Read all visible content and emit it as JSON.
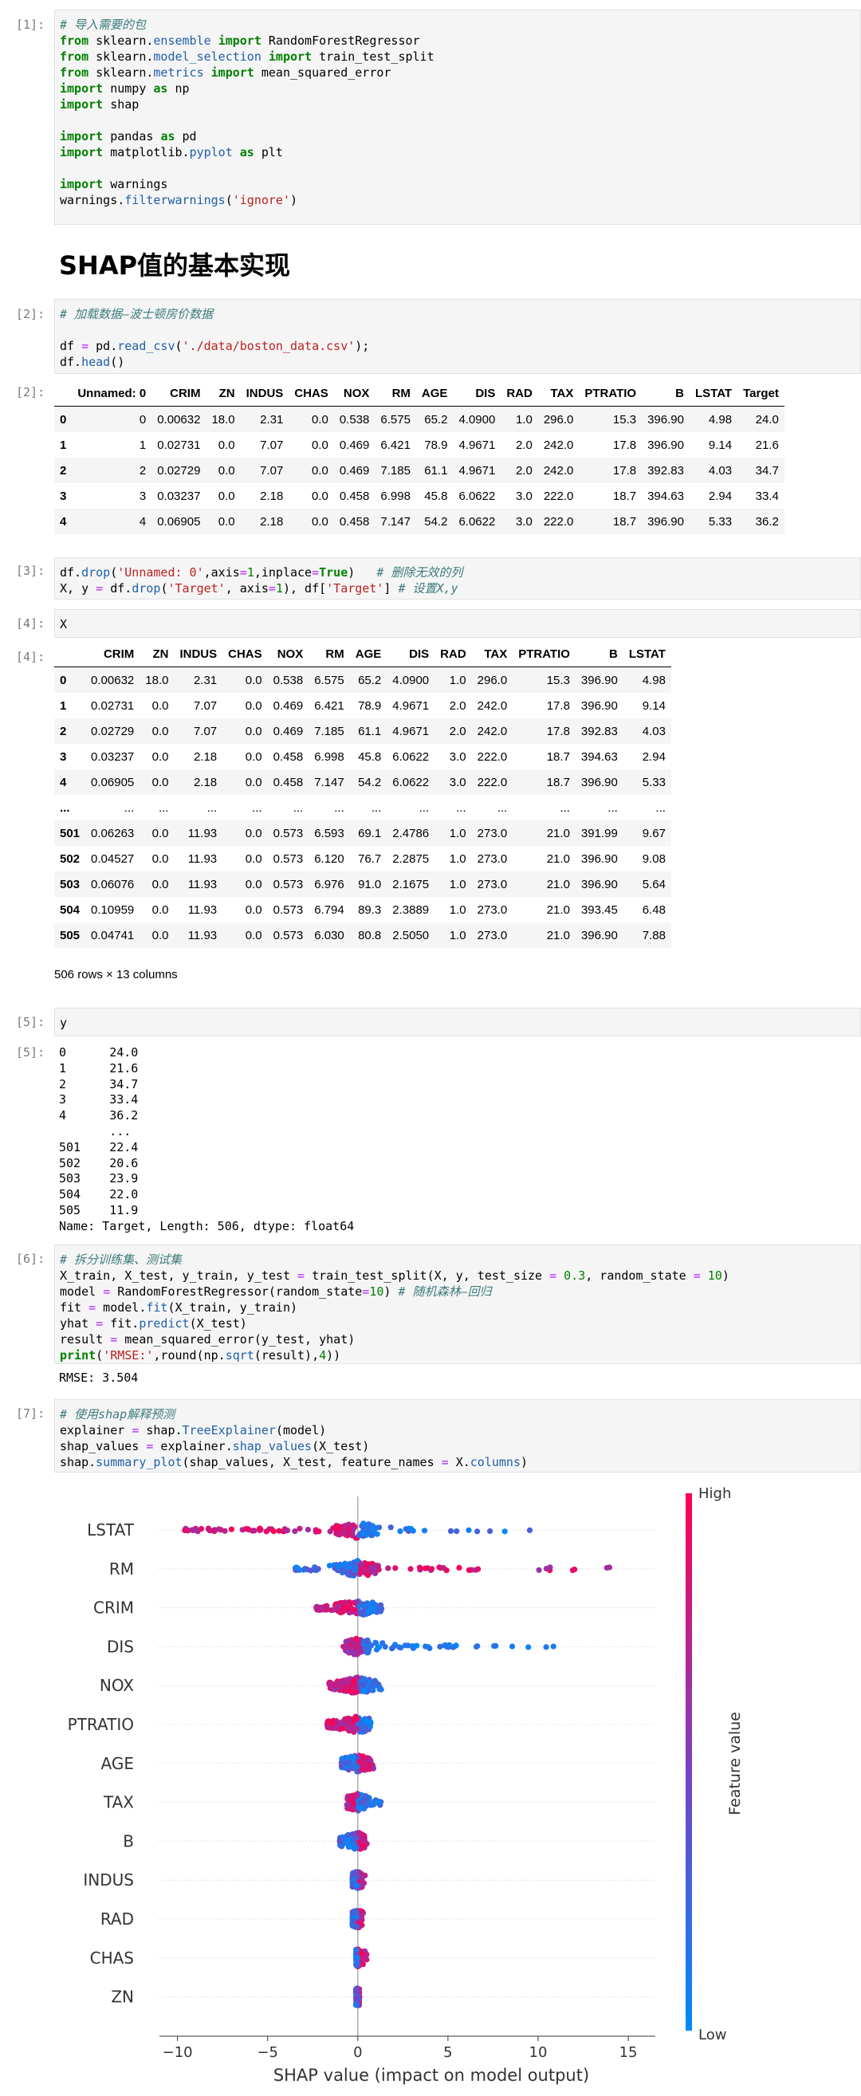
{
  "cells": {
    "c1": {
      "in": "[1]:"
    },
    "heading": "SHAP值的基本实现",
    "c2": {
      "in": "[2]:",
      "out": "[2]:"
    },
    "c3": {
      "in": "[3]:"
    },
    "c4": {
      "in": "[4]:",
      "out": "[4]:",
      "code": "X",
      "rows_info": "506 rows × 13 columns"
    },
    "c5": {
      "in": "[5]:",
      "out": "[5]:",
      "code": "y",
      "output": "0      24.0\n1      21.6\n2      34.7\n3      33.4\n4      36.2\n       ...\n501    22.4\n502    20.6\n503    23.9\n504    22.0\n505    11.9\nName: Target, Length: 506, dtype: float64"
    },
    "c6": {
      "in": "[6]:",
      "output": "RMSE: 3.504"
    },
    "c7": {
      "in": "[7]:"
    }
  },
  "table_full": {
    "columns": [
      "",
      "Unnamed: 0",
      "CRIM",
      "ZN",
      "INDUS",
      "CHAS",
      "NOX",
      "RM",
      "AGE",
      "DIS",
      "RAD",
      "TAX",
      "PTRATIO",
      "B",
      "LSTAT",
      "Target"
    ],
    "rows": [
      [
        "0",
        "0",
        "0.00632",
        "18.0",
        "2.31",
        "0.0",
        "0.538",
        "6.575",
        "65.2",
        "4.0900",
        "1.0",
        "296.0",
        "15.3",
        "396.90",
        "4.98",
        "24.0"
      ],
      [
        "1",
        "1",
        "0.02731",
        "0.0",
        "7.07",
        "0.0",
        "0.469",
        "6.421",
        "78.9",
        "4.9671",
        "2.0",
        "242.0",
        "17.8",
        "396.90",
        "9.14",
        "21.6"
      ],
      [
        "2",
        "2",
        "0.02729",
        "0.0",
        "7.07",
        "0.0",
        "0.469",
        "7.185",
        "61.1",
        "4.9671",
        "2.0",
        "242.0",
        "17.8",
        "392.83",
        "4.03",
        "34.7"
      ],
      [
        "3",
        "3",
        "0.03237",
        "0.0",
        "2.18",
        "0.0",
        "0.458",
        "6.998",
        "45.8",
        "6.0622",
        "3.0",
        "222.0",
        "18.7",
        "394.63",
        "2.94",
        "33.4"
      ],
      [
        "4",
        "4",
        "0.06905",
        "0.0",
        "2.18",
        "0.0",
        "0.458",
        "7.147",
        "54.2",
        "6.0622",
        "3.0",
        "222.0",
        "18.7",
        "396.90",
        "5.33",
        "36.2"
      ]
    ]
  },
  "table_x": {
    "columns": [
      "",
      "CRIM",
      "ZN",
      "INDUS",
      "CHAS",
      "NOX",
      "RM",
      "AGE",
      "DIS",
      "RAD",
      "TAX",
      "PTRATIO",
      "B",
      "LSTAT"
    ],
    "rows": [
      [
        "0",
        "0.00632",
        "18.0",
        "2.31",
        "0.0",
        "0.538",
        "6.575",
        "65.2",
        "4.0900",
        "1.0",
        "296.0",
        "15.3",
        "396.90",
        "4.98"
      ],
      [
        "1",
        "0.02731",
        "0.0",
        "7.07",
        "0.0",
        "0.469",
        "6.421",
        "78.9",
        "4.9671",
        "2.0",
        "242.0",
        "17.8",
        "396.90",
        "9.14"
      ],
      [
        "2",
        "0.02729",
        "0.0",
        "7.07",
        "0.0",
        "0.469",
        "7.185",
        "61.1",
        "4.9671",
        "2.0",
        "242.0",
        "17.8",
        "392.83",
        "4.03"
      ],
      [
        "3",
        "0.03237",
        "0.0",
        "2.18",
        "0.0",
        "0.458",
        "6.998",
        "45.8",
        "6.0622",
        "3.0",
        "222.0",
        "18.7",
        "394.63",
        "2.94"
      ],
      [
        "4",
        "0.06905",
        "0.0",
        "2.18",
        "0.0",
        "0.458",
        "7.147",
        "54.2",
        "6.0622",
        "3.0",
        "222.0",
        "18.7",
        "396.90",
        "5.33"
      ],
      [
        "...",
        "...",
        "...",
        "...",
        "...",
        "...",
        "...",
        "...",
        "...",
        "...",
        "...",
        "...",
        "...",
        "..."
      ],
      [
        "501",
        "0.06263",
        "0.0",
        "11.93",
        "0.0",
        "0.573",
        "6.593",
        "69.1",
        "2.4786",
        "1.0",
        "273.0",
        "21.0",
        "391.99",
        "9.67"
      ],
      [
        "502",
        "0.04527",
        "0.0",
        "11.93",
        "0.0",
        "0.573",
        "6.120",
        "76.7",
        "2.2875",
        "1.0",
        "273.0",
        "21.0",
        "396.90",
        "9.08"
      ],
      [
        "503",
        "0.06076",
        "0.0",
        "11.93",
        "0.0",
        "0.573",
        "6.976",
        "91.0",
        "2.1675",
        "1.0",
        "273.0",
        "21.0",
        "396.90",
        "5.64"
      ],
      [
        "504",
        "0.10959",
        "0.0",
        "11.93",
        "0.0",
        "0.573",
        "6.794",
        "89.3",
        "2.3889",
        "1.0",
        "273.0",
        "21.0",
        "393.45",
        "6.48"
      ],
      [
        "505",
        "0.04741",
        "0.0",
        "11.93",
        "0.0",
        "0.573",
        "6.030",
        "80.8",
        "2.5050",
        "1.0",
        "273.0",
        "21.0",
        "396.90",
        "7.88"
      ]
    ]
  },
  "chart_data": {
    "type": "scatter",
    "xlabel": "SHAP value (impact on model output)",
    "xlim": [
      -11,
      16.5
    ],
    "xticks": [
      -10,
      -5,
      0,
      5,
      10,
      15
    ],
    "colorbar": {
      "label": "Feature value",
      "high": "High",
      "low": "Low",
      "high_color": "#ff0052",
      "low_color": "#008bfb"
    },
    "features": [
      {
        "name": "LSTAT",
        "min": -9.6,
        "max": 11.0
      },
      {
        "name": "RM",
        "min": -3.5,
        "max": 15.2
      },
      {
        "name": "CRIM",
        "min": -2.3,
        "max": 1.4
      },
      {
        "name": "DIS",
        "min": -0.8,
        "max": 11.9
      },
      {
        "name": "NOX",
        "min": -1.6,
        "max": 1.3
      },
      {
        "name": "PTRATIO",
        "min": -1.7,
        "max": 0.9
      },
      {
        "name": "AGE",
        "min": -0.9,
        "max": 1.0
      },
      {
        "name": "TAX",
        "min": -0.6,
        "max": 1.3
      },
      {
        "name": "B",
        "min": -1.0,
        "max": 0.5
      },
      {
        "name": "INDUS",
        "min": -0.3,
        "max": 0.4
      },
      {
        "name": "RAD",
        "min": -0.3,
        "max": 0.3
      },
      {
        "name": "CHAS",
        "min": -0.1,
        "max": 0.5
      },
      {
        "name": "ZN",
        "min": -0.1,
        "max": 0.1
      }
    ]
  }
}
